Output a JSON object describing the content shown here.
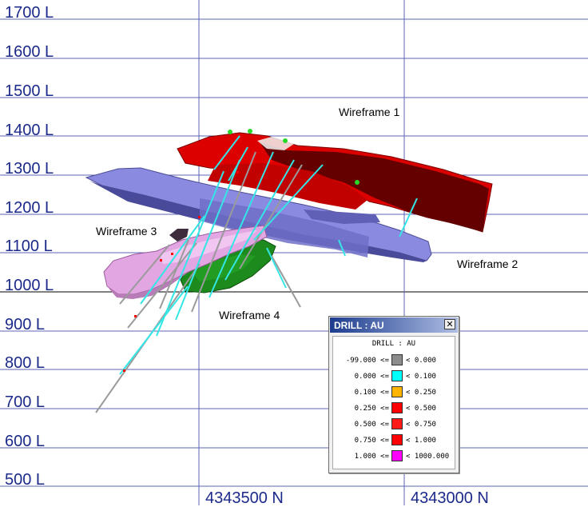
{
  "section": {
    "level_labels": [
      "1700 L",
      "1600 L",
      "1500 L",
      "1400 L",
      "1300 L",
      "1200 L",
      "1100 L",
      "1000 L",
      "900 L",
      "800 L",
      "700 L",
      "600 L",
      "500 L"
    ],
    "northing_labels": [
      "4343500 N",
      "4343000 N"
    ],
    "wireframe_labels": [
      "Wireframe 1",
      "Wireframe 2",
      "Wireframe 3",
      "Wireframe 4"
    ]
  },
  "colors": {
    "grid": "#5d65b7",
    "level_text": "#1b2a8a",
    "wireframe_1": "#dd0000",
    "wireframe_1_dark": "#5a0000",
    "wireframe_2": "#8a8ae0",
    "wireframe_3": "#e2a6e2",
    "wireframe_4": "#1d8a1d",
    "drill_trace_low": "#9a9a9a",
    "drill_trace_high": "#34e6e6"
  },
  "legend": {
    "title": "DRILL : AU",
    "close_glyph": "✕",
    "subtitle": "DRILL : AU",
    "rows": [
      {
        "low": "-99.000 <=",
        "color": "#8c8c8c",
        "high": "< 0.000"
      },
      {
        "low": "0.000 <=",
        "color": "#00ffff",
        "high": "< 0.100"
      },
      {
        "low": "0.100 <=",
        "color": "#ffb400",
        "high": "< 0.250"
      },
      {
        "low": "0.250 <=",
        "color": "#ff0000",
        "high": "< 0.500"
      },
      {
        "low": "0.500 <=",
        "color": "#ff1a1a",
        "high": "< 0.750"
      },
      {
        "low": "0.750 <=",
        "color": "#ff0000",
        "high": "< 1.000"
      },
      {
        "low": "1.000 <=",
        "color": "#ff00ff",
        "high": "< 1000.000"
      }
    ]
  }
}
